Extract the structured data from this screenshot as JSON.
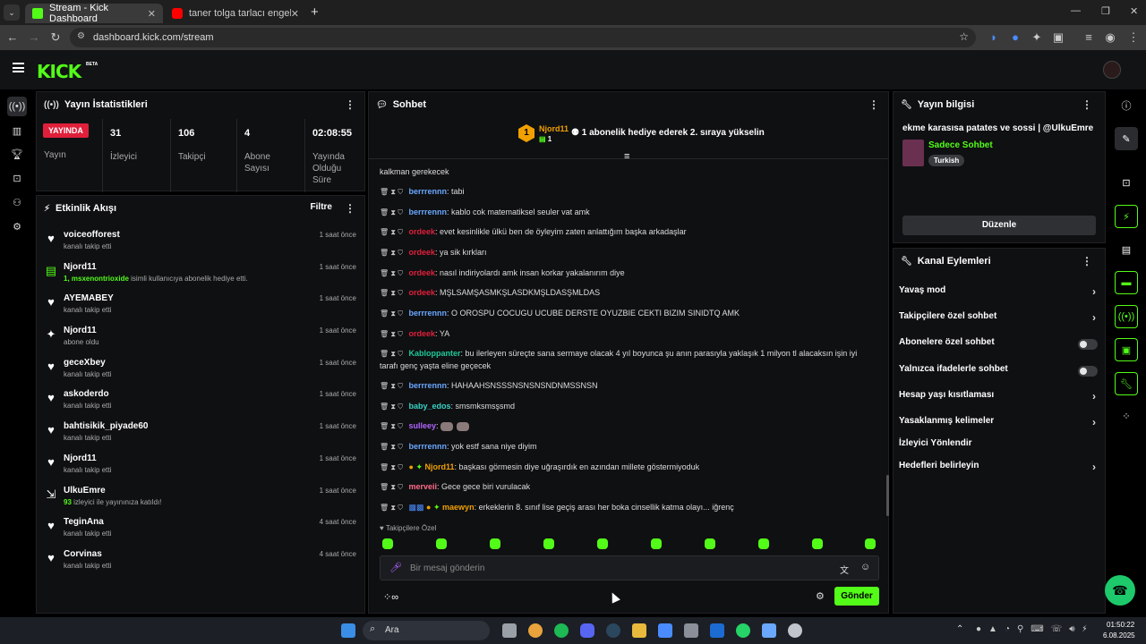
{
  "browser": {
    "tabs": [
      {
        "title": "Stream - Kick Dashboard",
        "active": true
      },
      {
        "title": "taner tolga tarlacı engelli hayra",
        "active": false
      }
    ],
    "url": "dashboard.kick.com/stream",
    "new_tab": "+"
  },
  "app": {
    "logo": "KICK",
    "beta": "BETA"
  },
  "stats_panel": {
    "title": "Yayın İstatistikleri",
    "live_badge": "YAYINDA",
    "live_label": "Yayın",
    "viewers_value": "31",
    "viewers_label": "İzleyici",
    "followers_value": "106",
    "followers_label": "Takipçi",
    "subs_value": "4",
    "subs_label_1": "Abone",
    "subs_label_2": "Sayısı",
    "uptime_value": "02:08:55",
    "uptime_label_1": "Yayında",
    "uptime_label_2": "Olduğu",
    "uptime_label_3": "Süre"
  },
  "activity": {
    "title": "Etkinlik Akışı",
    "filter": "Filtre",
    "items": [
      {
        "name": "voiceofforest",
        "desc": "kanalı takip etti",
        "time": "1 saat önce"
      },
      {
        "name": "Njord11",
        "desc_hl": "1, msxenontrioxide",
        "desc": " isimli kullanıcıya abonelik hediye etti.",
        "time": "1 saat önce"
      },
      {
        "name": "AYEMABEY",
        "desc": "kanalı takip etti",
        "time": "1 saat önce"
      },
      {
        "name": "Njord11",
        "desc": "abone oldu",
        "time": "1 saat önce"
      },
      {
        "name": "geceXbey",
        "desc": "kanalı takip etti",
        "time": "1 saat önce"
      },
      {
        "name": "askoderdo",
        "desc": "kanalı takip etti",
        "time": "1 saat önce"
      },
      {
        "name": "bahtisikik_piyade60",
        "desc": "kanalı takip etti",
        "time": "1 saat önce"
      },
      {
        "name": "Njord11",
        "desc": "kanalı takip etti",
        "time": "1 saat önce"
      },
      {
        "name": "UlkuEmre",
        "desc_hl": "93",
        "desc": " izleyici ile yayınınıza katıldı!",
        "time": "1 saat önce"
      },
      {
        "name": "TeginAna",
        "desc": "kanalı takip etti",
        "time": "4 saat önce"
      },
      {
        "name": "Corvinas",
        "desc": "kanalı takip etti",
        "time": "4 saat önce"
      }
    ]
  },
  "chat": {
    "title": "Sohbet",
    "top_gifter": "Njord11",
    "top_gifter_count": "1",
    "gift_prompt": "1 abonelik hediye ederek 2. sıraya yükselin",
    "partial_line": "kalkman gerekecek",
    "messages": [
      {
        "user": "berrrennn",
        "text": ": tabi",
        "color": "#6aa7ff"
      },
      {
        "user": "berrrennn",
        "text": ": kablo cok matematiksel seuler vat amk",
        "color": "#6aa7ff"
      },
      {
        "user": "ordeek",
        "text": ": evet kesinlikle ülkü ben de öyleyim zaten anlattığım başka arkadaşlar",
        "color": "#e0203b"
      },
      {
        "user": "ordeek",
        "text": ": ya sik kırkları",
        "color": "#e0203b"
      },
      {
        "user": "ordeek",
        "text": ": nasıl indiriyolardı amk insan korkar yakalanırım diye",
        "color": "#e0203b"
      },
      {
        "user": "ordeek",
        "text": ": MŞLSAMŞASMKŞLASDKMŞLDASŞMLDAS",
        "color": "#e0203b"
      },
      {
        "user": "berrrennn",
        "text": ": O OROSPU COCUGU UCUBE DERSTE OYUZBIE CEKTI BIZIM SINIDTQ AMK",
        "color": "#6aa7ff"
      },
      {
        "user": "ordeek",
        "text": ": YA",
        "color": "#e0203b"
      },
      {
        "user": "Kabloppanter",
        "text": ": bu ilerleyen süreçte sana sermaye olacak 4 yıl boyunca şu anın parasıyla yaklaşık 1 milyon tl alacaksın işin iyi",
        "color": "#1dc999"
      },
      {
        "user": "",
        "text": "tarafı genç yaşta eline geçecek",
        "color": "#ddd"
      },
      {
        "user": "berrrennn",
        "text": ": HAHAAHSNSSSNSNSNSNDNMSSNSN",
        "color": "#6aa7ff"
      },
      {
        "user": "baby_edos",
        "text": ": smsmksmsşsmd",
        "color": "#37d3c5"
      },
      {
        "user": "sulleey",
        "text": ":",
        "color": "#b265ff"
      },
      {
        "user": "berrrennn",
        "text": ": yok estf sana niye diyim",
        "color": "#6aa7ff"
      },
      {
        "user": "Njord11",
        "text": ": başkası görmesin diye uğraşırdık en azından millete göstermiyoduk",
        "color": "#f0a000"
      },
      {
        "user": "merveii",
        "text": ": Gece gece biri vurulacak",
        "color": "#ff6b8a"
      },
      {
        "user": "maewyn",
        "text": ": erkeklerin 8. sınıf lise geçiş arası her boka cinsellik katma olayı... iğrenç",
        "color": "#f0a000"
      }
    ],
    "followers_only": "Takipçilere Özel",
    "input_placeholder": "Bir mesaj gönderin",
    "send": "Gönder"
  },
  "stream_info": {
    "title": "Yayın bilgisi",
    "stream_title": "ekme karasısa patates ve sossi | @UlkuEmre",
    "category": "Sadece Sohbet",
    "tag": "Turkish",
    "edit": "Düzenle"
  },
  "channel_actions": {
    "title": "Kanal Eylemleri",
    "items": [
      {
        "label": "Yavaş mod",
        "kind": "chevron"
      },
      {
        "label": "Takipçilere özel sohbet",
        "kind": "chevron"
      },
      {
        "label": "Abonelere özel sohbet",
        "kind": "toggle"
      },
      {
        "label": "Yalnızca ifadelerle sohbet",
        "kind": "toggle"
      },
      {
        "label": "Hesap yaşı kısıtlaması",
        "kind": "chevron"
      },
      {
        "label": "Yasaklanmış kelimeler",
        "kind": "chevron"
      },
      {
        "label": "İzleyici Yönlendir",
        "kind": "none"
      },
      {
        "label": "Hedefleri belirleyin",
        "kind": "chevron"
      }
    ]
  },
  "taskbar": {
    "search": "Ara",
    "time": "01:50:22",
    "date": "6.08.2025"
  },
  "colors": {
    "kick_green": "#53fc18",
    "live_red": "#e0203b",
    "panel_bg": "#0f1012"
  }
}
